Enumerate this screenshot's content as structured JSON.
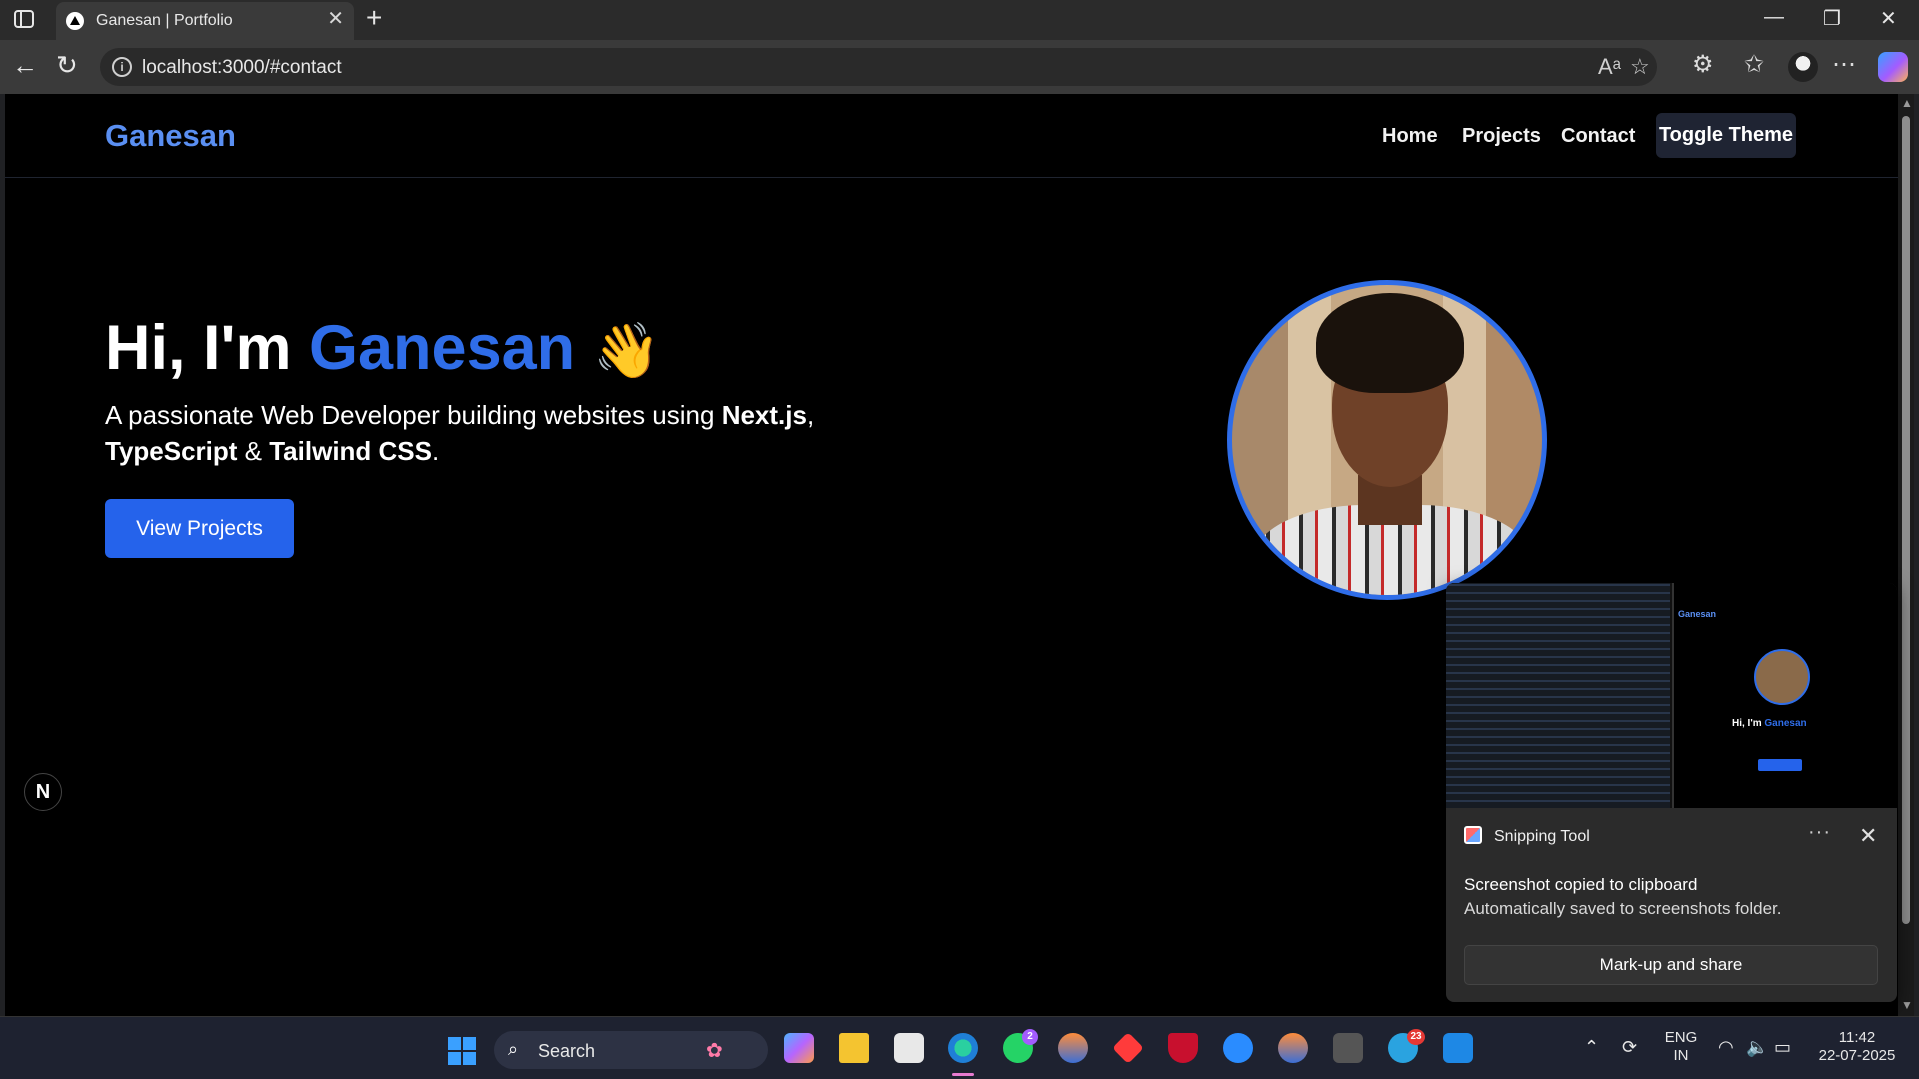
{
  "browser": {
    "tab_title": "Ganesan | Portfolio",
    "url": "localhost:3000/#contact"
  },
  "site": {
    "brand": "Ganesan",
    "nav": [
      "Home",
      "Projects",
      "Contact"
    ],
    "toggle_theme": "Toggle Theme",
    "hero": {
      "greeting": "Hi, I'm ",
      "name": "Ganesan",
      "wave": "👋",
      "sub_intro": "A passionate Web Developer building websites using ",
      "tech1": "Next.js",
      "sep1": ", ",
      "tech2": "TypeScript",
      "sep2": " & ",
      "tech3": "Tailwind CSS",
      "end": ".",
      "cta": "View Projects"
    },
    "nextjs_badge": "N",
    "accent_color": "#2f6de8"
  },
  "toast": {
    "app_name": "Snipping Tool",
    "title": "Screenshot copied to clipboard",
    "body": "Automatically saved to screenshots folder.",
    "action": "Mark-up and share",
    "preview": {
      "brand": "Ganesan",
      "title_prefix": "Hi, I'm ",
      "title_name": "Ganesan"
    }
  },
  "taskbar": {
    "search_label": "Search",
    "whatsapp_badge": "2",
    "telegram_badge": "23",
    "lang_line1": "ENG",
    "lang_line2": "IN",
    "time": "11:42",
    "date": "22-07-2025"
  }
}
